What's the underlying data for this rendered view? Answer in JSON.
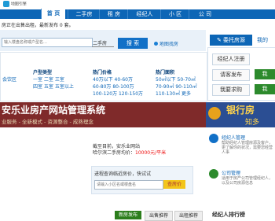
{
  "logo": {
    "icon": "house-logo-icon",
    "text": "地图引擎"
  },
  "nav": {
    "tabs": [
      "首 页",
      "二手房",
      "租 房",
      "经纪人",
      "小 区",
      "公 司"
    ],
    "active": 0
  },
  "notice": "房正在出售出租，最新发布 0 套。",
  "search": {
    "placeholder": "输入楼盘名称或户型名…",
    "type": "二手房",
    "button": "搜 索",
    "map": "地图找房"
  },
  "filters": {
    "c1": {
      "title": "户型类型",
      "rows": [
        "一室  二室  三室",
        "四室  五室  五室以上"
      ],
      "left": "会饮区"
    },
    "c2": {
      "title": "热门价格",
      "rows": [
        "40万以下  40-60万",
        "60-80万  80-100万",
        "100-120万  120-150万"
      ]
    },
    "c3": {
      "title": "热门面积",
      "rows": [
        "50㎡以下  50-70㎡",
        "70-90㎡  90-110㎡",
        "110-130㎡  更多"
      ]
    }
  },
  "banner": {
    "title": "安乐业房产网站管理系统",
    "subtitle": "业服务 - 全新模式 - 资源整合 - 成熟理念",
    "ad1": "银行房",
    "ad2": "知多"
  },
  "assess": {
    "l1": "截至目前，安乐业网站",
    "l2": "哈尔滨二手房均价：",
    "price": "10000元/平米",
    "hint": "进程查询临近房价，快试试",
    "placeholder": "请输入小区名或楼盘名",
    "btn": "查房价"
  },
  "bottom_buttons": [
    "新房发布",
    "出售推荐",
    "出租推荐"
  ],
  "right": {
    "entrust": "委托房源",
    "entrust_icon": "pencil-icon",
    "tab2": "我的",
    "links": [
      "经纪人注册",
      "请客发布",
      "我要求购"
    ],
    "green1": "我",
    "green2": "我",
    "broker": {
      "title": "经纪人管理",
      "desc": "帮助经纪人管理房源及客户，更了解你的状况，需要您经营人事"
    },
    "company": {
      "title": "公司管理",
      "desc": "适用于房产公司管理经纪人，以及公司房源信息"
    },
    "rank": "经纪人排行榜"
  }
}
